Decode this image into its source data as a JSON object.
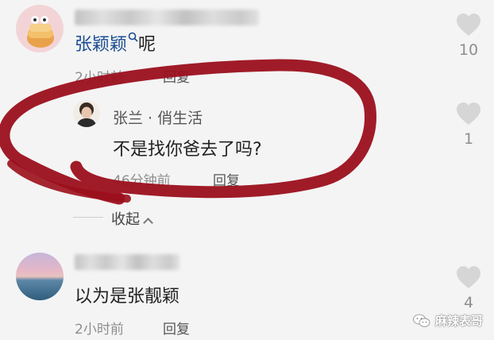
{
  "comments": [
    {
      "name_mention": "张颖颖",
      "text_suffix": "呢",
      "time": "2小时前",
      "reply_label": "回复",
      "likes": "10"
    },
    {
      "author": "张兰 · 俏生活",
      "text": "不是找你爸去了吗?",
      "time": "46分钟前",
      "reply_label": "回复",
      "likes": "1"
    },
    {
      "text": "以为是张靓颖",
      "time": "2小时前",
      "reply_label": "回复",
      "likes": "4"
    }
  ],
  "collapse_label": "收起",
  "watermark": "麻辣表哥",
  "colors": {
    "background": "#f4f4f4",
    "mention": "#1a4c91",
    "meta": "#8e8e8e",
    "heart": "#d6d6d6",
    "scribble": "#9b0f1c"
  },
  "icons": [
    "search-icon",
    "heart-icon",
    "chevron-up-icon",
    "wechat-icon"
  ]
}
